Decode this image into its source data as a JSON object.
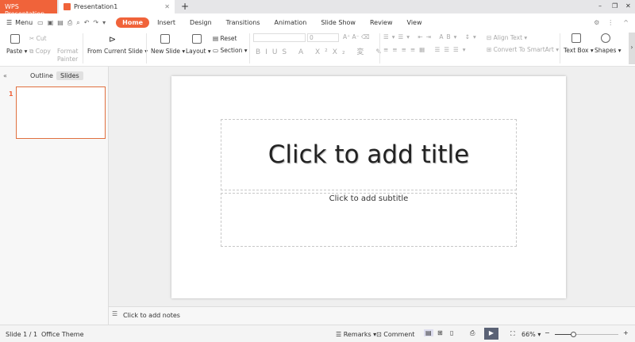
{
  "titlebar": {
    "app_tab": "WPS Presentation",
    "doc_tab": "Presentation1",
    "new_tab": "+",
    "min": "–",
    "restore": "❐",
    "close": "✕"
  },
  "menu": {
    "menu_label": "Menu",
    "tabs": [
      "Home",
      "Insert",
      "Design",
      "Transitions",
      "Animation",
      "Slide Show",
      "Review",
      "View"
    ]
  },
  "ribbon": {
    "paste": "Paste",
    "cut": "Cut",
    "copy": "Copy",
    "format_painter_1": "Format",
    "format_painter_2": "Painter",
    "from_current": "From Current Slide",
    "new_slide": "New Slide",
    "layout": "Layout",
    "reset": "Reset",
    "section": "Section",
    "font_size": "0",
    "align_text": "Align Text",
    "smartart": "Convert To SmartArt",
    "text_box": "Text Box",
    "shapes": "Shapes"
  },
  "left_panel": {
    "tabs": [
      "Outline",
      "Slides"
    ],
    "slide_number": "1"
  },
  "slide": {
    "title_placeholder": "Click to add title",
    "subtitle_placeholder": "Click to add subtitle"
  },
  "notes": {
    "placeholder": "Click to add notes"
  },
  "status": {
    "slide_info": "Slide 1 / 1",
    "theme": "Office Theme",
    "remarks": "Remarks",
    "comment": "Comment",
    "zoom": "66%",
    "zoom_level": 66
  },
  "colors": {
    "accent": "#f0633a"
  }
}
